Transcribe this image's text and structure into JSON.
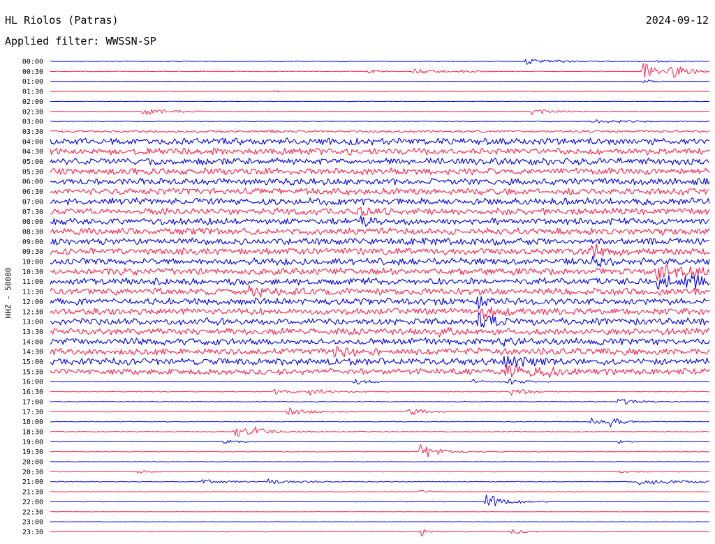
{
  "header": {
    "station": "HL Riolos (Patras)",
    "date": "2024-09-12",
    "filter": "Applied filter: WWSSN-SP"
  },
  "chart_data": {
    "type": "helicorder",
    "title": "HL Riolos (Patras)",
    "date": "2024-09-12",
    "filter": "WWSSN-SP",
    "ylabel": "HHZ - 50000",
    "xlabel": "",
    "colors": [
      "#0000ee",
      "#ff1f4b"
    ],
    "grid": false,
    "rows": [
      {
        "time": "00:00",
        "noise": 0.08,
        "events": [
          {
            "at": 0.17,
            "amp": 0.25,
            "dur": 0.02
          },
          {
            "at": 0.44,
            "amp": 0.2,
            "dur": 0.01
          },
          {
            "at": 0.72,
            "amp": 0.9,
            "dur": 0.05
          },
          {
            "at": 0.92,
            "amp": 0.4,
            "dur": 0.01
          }
        ]
      },
      {
        "time": "00:30",
        "noise": 0.1,
        "events": [
          {
            "at": 0.48,
            "amp": 0.7,
            "dur": 0.02
          },
          {
            "at": 0.55,
            "amp": 1.2,
            "dur": 0.03
          },
          {
            "at": 0.62,
            "amp": 0.4,
            "dur": 0.02
          },
          {
            "at": 0.9,
            "amp": 3.5,
            "dur": 0.02
          },
          {
            "at": 0.94,
            "amp": 1.6,
            "dur": 0.04
          }
        ]
      },
      {
        "time": "01:00",
        "noise": 0.05,
        "events": [
          {
            "at": 0.9,
            "amp": 2.0,
            "dur": 0.01
          }
        ]
      },
      {
        "time": "01:30",
        "noise": 0.05,
        "events": [
          {
            "at": 0.34,
            "amp": 0.7,
            "dur": 0.01
          }
        ]
      },
      {
        "time": "02:00",
        "noise": 0.07,
        "events": []
      },
      {
        "time": "02:30",
        "noise": 0.1,
        "events": [
          {
            "at": 0.14,
            "amp": 1.2,
            "dur": 0.04
          },
          {
            "at": 0.73,
            "amp": 1.2,
            "dur": 0.03
          }
        ]
      },
      {
        "time": "03:00",
        "noise": 0.12,
        "events": [
          {
            "at": 0.82,
            "amp": 0.6,
            "dur": 0.05
          }
        ]
      },
      {
        "time": "03:30",
        "noise": 0.35,
        "events": [
          {
            "at": 0.33,
            "amp": 0.6,
            "dur": 0.01
          }
        ]
      },
      {
        "time": "04:00",
        "noise": 1.0,
        "events": []
      },
      {
        "time": "04:30",
        "noise": 1.0,
        "events": []
      },
      {
        "time": "05:00",
        "noise": 1.0,
        "events": []
      },
      {
        "time": "05:30",
        "noise": 1.0,
        "events": []
      },
      {
        "time": "06:00",
        "noise": 1.0,
        "events": []
      },
      {
        "time": "06:30",
        "noise": 1.0,
        "events": []
      },
      {
        "time": "07:00",
        "noise": 1.0,
        "events": []
      },
      {
        "time": "07:30",
        "noise": 1.0,
        "events": [
          {
            "at": 0.47,
            "amp": 1.6,
            "dur": 0.01
          }
        ]
      },
      {
        "time": "08:00",
        "noise": 1.0,
        "events": [
          {
            "at": 0.47,
            "amp": 1.6,
            "dur": 0.01
          }
        ]
      },
      {
        "time": "08:30",
        "noise": 1.0,
        "events": [
          {
            "at": 0.93,
            "amp": 1.5,
            "dur": 0.01
          }
        ]
      },
      {
        "time": "09:00",
        "noise": 1.0,
        "events": []
      },
      {
        "time": "09:30",
        "noise": 1.0,
        "events": [
          {
            "at": 0.82,
            "amp": 1.8,
            "dur": 0.02
          }
        ]
      },
      {
        "time": "10:00",
        "noise": 1.0,
        "events": [
          {
            "at": 0.82,
            "amp": 2.0,
            "dur": 0.02
          }
        ]
      },
      {
        "time": "10:30",
        "noise": 1.0,
        "events": [
          {
            "at": 0.92,
            "amp": 2.8,
            "dur": 0.02
          },
          {
            "at": 0.96,
            "amp": 2.6,
            "dur": 0.02
          }
        ]
      },
      {
        "time": "11:00",
        "noise": 1.0,
        "events": [
          {
            "at": 0.92,
            "amp": 2.4,
            "dur": 0.03
          },
          {
            "at": 0.96,
            "amp": 2.4,
            "dur": 0.03
          }
        ]
      },
      {
        "time": "11:30",
        "noise": 1.0,
        "events": [
          {
            "at": 0.3,
            "amp": 1.6,
            "dur": 0.02
          }
        ]
      },
      {
        "time": "12:00",
        "noise": 1.0,
        "events": [
          {
            "at": 0.65,
            "amp": 1.6,
            "dur": 0.01
          }
        ]
      },
      {
        "time": "12:30",
        "noise": 1.0,
        "events": [
          {
            "at": 0.65,
            "amp": 2.6,
            "dur": 0.02
          }
        ]
      },
      {
        "time": "13:00",
        "noise": 1.0,
        "events": [
          {
            "at": 0.65,
            "amp": 2.2,
            "dur": 0.02
          }
        ]
      },
      {
        "time": "13:30",
        "noise": 1.0,
        "events": [
          {
            "at": 0.59,
            "amp": 1.6,
            "dur": 0.01
          }
        ]
      },
      {
        "time": "14:00",
        "noise": 1.0,
        "events": [
          {
            "at": 0.68,
            "amp": 1.8,
            "dur": 0.02
          }
        ]
      },
      {
        "time": "14:30",
        "noise": 1.0,
        "events": [
          {
            "at": 0.43,
            "amp": 1.8,
            "dur": 0.02
          }
        ]
      },
      {
        "time": "15:00",
        "noise": 1.0,
        "events": [
          {
            "at": 0.69,
            "amp": 2.4,
            "dur": 0.03
          }
        ]
      },
      {
        "time": "15:30",
        "noise": 0.9,
        "events": [
          {
            "at": 0.69,
            "amp": 2.8,
            "dur": 0.04
          },
          {
            "at": 0.75,
            "amp": 1.6,
            "dur": 0.01
          }
        ]
      },
      {
        "time": "16:00",
        "noise": 0.1,
        "events": [
          {
            "at": 0.46,
            "amp": 1.4,
            "dur": 0.02
          },
          {
            "at": 0.64,
            "amp": 0.8,
            "dur": 0.02
          },
          {
            "at": 0.69,
            "amp": 1.4,
            "dur": 0.02
          }
        ]
      },
      {
        "time": "16:30",
        "noise": 0.12,
        "events": [
          {
            "at": 0.34,
            "amp": 1.6,
            "dur": 0.02
          },
          {
            "at": 0.39,
            "amp": 1.0,
            "dur": 0.03
          },
          {
            "at": 0.7,
            "amp": 1.8,
            "dur": 0.02
          }
        ]
      },
      {
        "time": "17:00",
        "noise": 0.1,
        "events": [
          {
            "at": 0.86,
            "amp": 1.4,
            "dur": 0.02
          }
        ]
      },
      {
        "time": "17:30",
        "noise": 0.12,
        "events": [
          {
            "at": 0.36,
            "amp": 1.3,
            "dur": 0.03
          },
          {
            "at": 0.54,
            "amp": 1.4,
            "dur": 0.02
          }
        ]
      },
      {
        "time": "18:00",
        "noise": 0.1,
        "events": [
          {
            "at": 0.82,
            "amp": 1.4,
            "dur": 0.02
          },
          {
            "at": 0.85,
            "amp": 1.6,
            "dur": 0.02
          }
        ]
      },
      {
        "time": "18:30",
        "noise": 0.12,
        "events": [
          {
            "at": 0.28,
            "amp": 2.0,
            "dur": 0.03
          },
          {
            "at": 0.31,
            "amp": 0.8,
            "dur": 0.02
          }
        ]
      },
      {
        "time": "19:00",
        "noise": 0.08,
        "events": [
          {
            "at": 0.26,
            "amp": 0.7,
            "dur": 0.02
          },
          {
            "at": 0.86,
            "amp": 1.0,
            "dur": 0.01
          }
        ]
      },
      {
        "time": "19:30",
        "noise": 0.1,
        "events": [
          {
            "at": 0.56,
            "amp": 2.6,
            "dur": 0.03
          }
        ]
      },
      {
        "time": "20:00",
        "noise": 0.06,
        "events": []
      },
      {
        "time": "20:30",
        "noise": 0.08,
        "events": [
          {
            "at": 0.13,
            "amp": 0.4,
            "dur": 0.02
          },
          {
            "at": 0.86,
            "amp": 0.4,
            "dur": 0.03
          }
        ]
      },
      {
        "time": "21:00",
        "noise": 0.1,
        "events": [
          {
            "at": 0.23,
            "amp": 0.9,
            "dur": 0.03
          },
          {
            "at": 0.33,
            "amp": 0.8,
            "dur": 0.04
          },
          {
            "at": 0.89,
            "amp": 0.9,
            "dur": 0.07
          }
        ]
      },
      {
        "time": "21:30",
        "noise": 0.06,
        "events": [
          {
            "at": 0.56,
            "amp": 1.2,
            "dur": 0.01
          }
        ]
      },
      {
        "time": "22:00",
        "noise": 0.07,
        "events": [
          {
            "at": 0.66,
            "amp": 2.2,
            "dur": 0.03
          }
        ]
      },
      {
        "time": "22:30",
        "noise": 0.05,
        "events": []
      },
      {
        "time": "23:00",
        "noise": 0.05,
        "events": []
      },
      {
        "time": "23:30",
        "noise": 0.06,
        "events": [
          {
            "at": 0.56,
            "amp": 1.6,
            "dur": 0.01
          },
          {
            "at": 0.7,
            "amp": 0.8,
            "dur": 0.02
          }
        ]
      }
    ]
  }
}
